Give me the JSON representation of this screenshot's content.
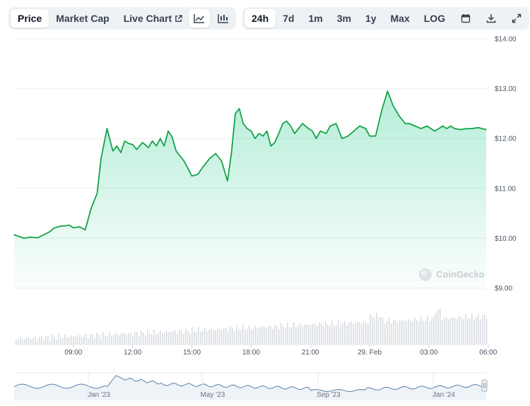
{
  "toolbar": {
    "views": [
      {
        "label": "Price",
        "active": true
      },
      {
        "label": "Market Cap",
        "active": false
      },
      {
        "label": "Live Chart",
        "active": false
      }
    ],
    "chart_styles": [
      {
        "icon": "line-chart-icon",
        "active": true
      },
      {
        "icon": "candlestick-chart-icon",
        "active": false
      }
    ],
    "ranges": [
      {
        "label": "24h",
        "active": true
      },
      {
        "label": "7d",
        "active": false
      },
      {
        "label": "1m",
        "active": false
      },
      {
        "label": "3m",
        "active": false
      },
      {
        "label": "1y",
        "active": false
      },
      {
        "label": "Max",
        "active": false
      },
      {
        "label": "LOG",
        "active": false
      }
    ],
    "actions": [
      {
        "icon": "calendar-icon"
      },
      {
        "icon": "download-icon"
      },
      {
        "icon": "expand-icon"
      }
    ]
  },
  "watermark": "CoinGecko",
  "colors": {
    "line": "#16a34a",
    "fill": "#16c784",
    "volume": "#d8dce1",
    "nav_line": "#5b7fa6"
  },
  "chart_data": {
    "type": "area",
    "ylim": [
      9,
      14
    ],
    "y_ticks": [
      "$14.00",
      "$13.00",
      "$12.00",
      "$11.00",
      "$10.00",
      "$9.00"
    ],
    "y_tick_values": [
      14,
      13,
      12,
      11,
      10,
      9
    ],
    "x_range": [
      0,
      23.9
    ],
    "x_tick_labels": [
      "09:00",
      "12:00",
      "15:00",
      "18:00",
      "21:00",
      "29. Feb",
      "03:00",
      "06:00"
    ],
    "x_tick_values": [
      3,
      6,
      9,
      12,
      15,
      18,
      21,
      24
    ],
    "series": [
      {
        "x": [
          0.0,
          0.5,
          0.8,
          1.2,
          1.5,
          1.8,
          2.0,
          2.3,
          2.8,
          3.0,
          3.3,
          3.6,
          3.9,
          4.2,
          4.4,
          4.7,
          5.0,
          5.2,
          5.4,
          5.6,
          5.8,
          6.0,
          6.2,
          6.5,
          6.8,
          7.0,
          7.2,
          7.4,
          7.6,
          7.8,
          8.0,
          8.2,
          8.4,
          8.6,
          8.8,
          9.0,
          9.3,
          9.6,
          9.9,
          10.2,
          10.5,
          10.8,
          11.0,
          11.2,
          11.4,
          11.6,
          11.8,
          12.0,
          12.2,
          12.4,
          12.6,
          12.8,
          13.0,
          13.2,
          13.4,
          13.6,
          13.8,
          14.0,
          14.2,
          14.4,
          14.6,
          14.9,
          15.1,
          15.3,
          15.5,
          15.8,
          16.0,
          16.3,
          16.6,
          16.9,
          17.2,
          17.5,
          17.8,
          18.0,
          18.3,
          18.6,
          18.9,
          19.2,
          19.5,
          19.8,
          20.0,
          20.3,
          20.6,
          20.9,
          21.1,
          21.3,
          21.5,
          21.7,
          21.9,
          22.1,
          22.3,
          22.6,
          22.9,
          23.2,
          23.5,
          23.9
        ],
        "y": [
          10.07,
          10.0,
          10.02,
          10.01,
          10.07,
          10.13,
          10.2,
          10.24,
          10.26,
          10.21,
          10.23,
          10.17,
          10.6,
          10.9,
          11.6,
          12.2,
          11.75,
          11.85,
          11.72,
          11.95,
          11.9,
          11.88,
          11.78,
          11.92,
          11.82,
          11.95,
          11.85,
          12.0,
          11.85,
          12.15,
          12.03,
          11.75,
          11.65,
          11.55,
          11.4,
          11.25,
          11.28,
          11.45,
          11.6,
          11.7,
          11.55,
          11.15,
          11.7,
          12.5,
          12.6,
          12.3,
          12.2,
          12.15,
          12.0,
          12.1,
          12.05,
          12.15,
          11.85,
          11.92,
          12.1,
          12.3,
          12.35,
          12.25,
          12.1,
          12.2,
          12.3,
          12.2,
          12.15,
          12.0,
          12.15,
          12.1,
          12.25,
          12.3,
          12.0,
          12.05,
          12.15,
          12.25,
          12.2,
          12.05,
          12.05,
          12.55,
          12.95,
          12.65,
          12.45,
          12.3,
          12.3,
          12.25,
          12.2,
          12.25,
          12.2,
          12.15,
          12.2,
          12.25,
          12.2,
          12.25,
          12.2,
          12.18,
          12.2,
          12.2,
          12.22,
          12.18
        ],
        "color": "#16a34a"
      }
    ],
    "navigator": {
      "x_tick_labels": [
        "Jan '23",
        "May '23",
        "Sep '23",
        "Jan '24"
      ]
    }
  }
}
